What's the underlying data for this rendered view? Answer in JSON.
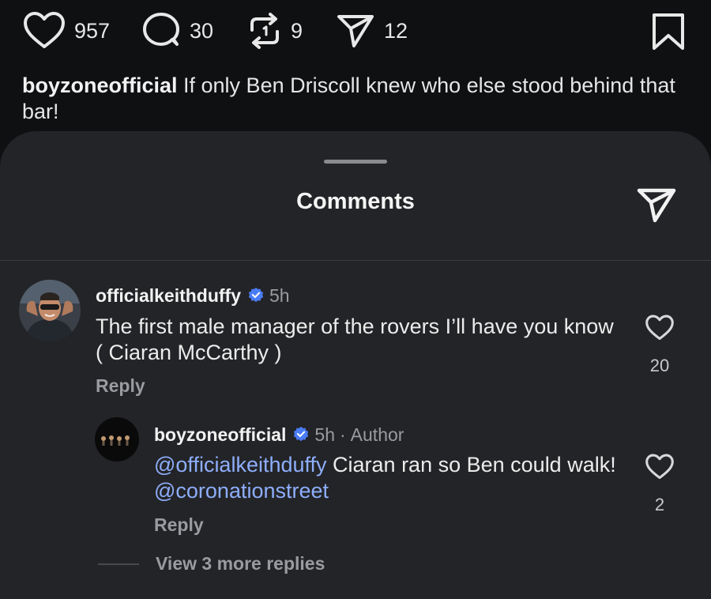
{
  "post": {
    "likes": "957",
    "comments": "30",
    "reposts": "9",
    "shares": "12",
    "caption_user": "boyzoneofficial",
    "caption_text": " If only Ben Driscoll knew who else stood behind that bar!"
  },
  "sheet": {
    "title": "Comments"
  },
  "comments": [
    {
      "user": "officialkeithduffy",
      "time": "5h",
      "text": "The first male manager of the rovers I’ll have you know ( Ciaran McCarthy )",
      "reply_label": "Reply",
      "likes": "20"
    },
    {
      "user": "boyzoneofficial",
      "time": "5h",
      "separator": "·",
      "author_badge": "Author",
      "mention1": "@officialkeithduffy",
      "text_mid": " Ciaran ran so Ben could walk! ",
      "mention2": "@coronationstreet",
      "reply_label": "Reply",
      "likes": "2"
    }
  ],
  "view_more": "View 3 more replies",
  "colors": {
    "background": "#0f1012",
    "sheet": "#232427",
    "mention": "#8eaefc",
    "verified": "#4a7cf6",
    "muted": "#9a9ba0"
  },
  "icons": [
    "heart-icon",
    "comment-bubble-icon",
    "repost-icon",
    "send-icon",
    "bookmark-icon",
    "verified-badge-icon"
  ]
}
